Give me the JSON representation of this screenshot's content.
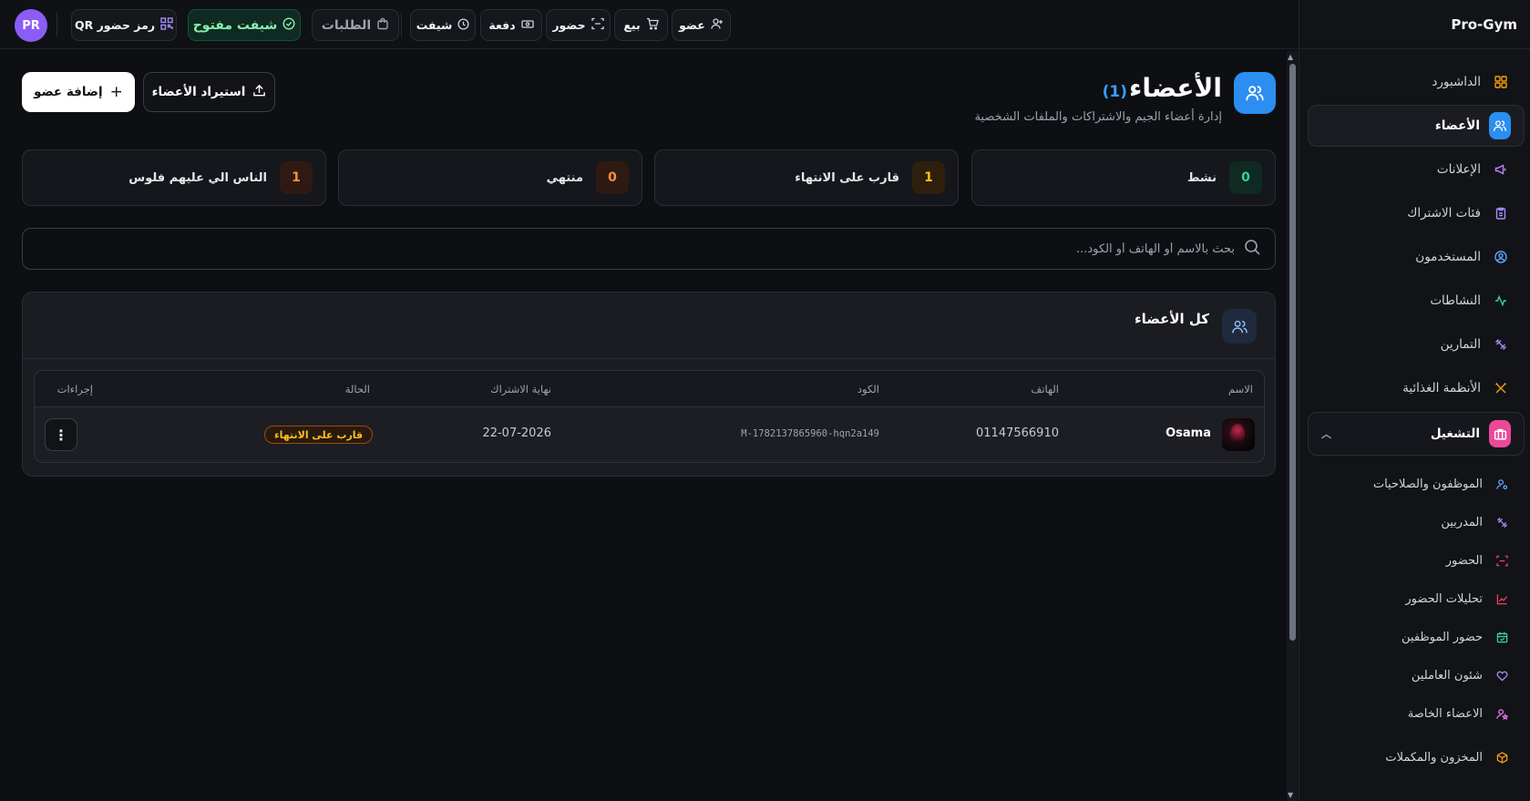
{
  "sidebar": {
    "brand": "Pro-Gym",
    "items": [
      {
        "label": "الداشبورد",
        "icon": "grid-icon",
        "color": "#f59e0b"
      },
      {
        "label": "الأعضاء",
        "icon": "users-icon",
        "color": "#ffffff",
        "bg": "#2b8ef0",
        "active": true
      },
      {
        "label": "الإعلانات",
        "icon": "megaphone-icon",
        "color": "#c084fc"
      },
      {
        "label": "فئات الاشتراك",
        "icon": "clipboard-icon",
        "color": "#a78bfa"
      },
      {
        "label": "المستخدمون",
        "icon": "user-circle-icon",
        "color": "#60a5fa"
      },
      {
        "label": "النشاطات",
        "icon": "activity-icon",
        "color": "#34d399"
      },
      {
        "label": "التمارين",
        "icon": "dumbbell-icon",
        "color": "#a78bfa"
      },
      {
        "label": "الأنظمة الغذائية",
        "icon": "utensils-icon",
        "color": "#f59e0b"
      }
    ],
    "group": {
      "label": "التشغيل",
      "icon": "briefcase-icon",
      "bg": "#ec4899"
    },
    "sub_items": [
      {
        "label": "الموظفون والصلاحيات",
        "icon": "user-cog-icon",
        "color": "#60a5fa"
      },
      {
        "label": "المدربين",
        "icon": "dumbbell-icon",
        "color": "#a78bfa"
      },
      {
        "label": "الحضور",
        "icon": "scan-icon",
        "color": "#f43f5e"
      },
      {
        "label": "تحليلات الحضور",
        "icon": "chart-line-icon",
        "color": "#f43f5e"
      },
      {
        "label": "حضور الموظفين",
        "icon": "calendar-check-icon",
        "color": "#34d399"
      },
      {
        "label": "شئون العاملين",
        "icon": "heart-handshake-icon",
        "color": "#a78bfa"
      },
      {
        "label": "الاعضاء الخاصة",
        "icon": "user-star-icon",
        "color": "#e879f9"
      },
      {
        "label": "المخزون والمكملات",
        "icon": "package-icon",
        "color": "#f59e0b"
      }
    ]
  },
  "topbar": {
    "avatar": "PR",
    "qr": "رمز حضور QR",
    "shift_open": "شيفت مفتوح",
    "requests": "الطلبات",
    "shift": "شيفت",
    "payment": "دفعة",
    "attendance": "حضور",
    "sale": "بيع",
    "member": "عضو"
  },
  "header": {
    "title": "الأعضاء",
    "count": "(1)",
    "subtitle": "إدارة أعضاء الجيم والاشتراكات والملفات الشخصية",
    "add_button": "إضافة عضو",
    "import_button": "استيراد الأعضاء"
  },
  "stats": [
    {
      "label": "نشط",
      "value": "0",
      "color": "#34d399",
      "bg": "#0f2a22"
    },
    {
      "label": "قارب على الانتهاء",
      "value": "1",
      "color": "#fbbf24",
      "bg": "#2e1f0c"
    },
    {
      "label": "منتهي",
      "value": "0",
      "color": "#fb923c",
      "bg": "#2e1a12"
    },
    {
      "label": "الناس الي عليهم فلوس",
      "value": "1",
      "color": "#fb923c",
      "bg": "#2e1a12"
    }
  ],
  "search": {
    "placeholder": "بحث بالاسم أو الهاتف أو الكود..."
  },
  "table": {
    "title": "كل الأعضاء",
    "columns": {
      "name": "الاسم",
      "phone": "الهاتف",
      "code": "الكود",
      "end": "نهاية الاشتراك",
      "status": "الحالة",
      "actions": "إجراءات"
    },
    "rows": [
      {
        "name": "Osama",
        "phone": "01147566910",
        "code": "M-1782137865960-hqn2a149",
        "end": "22-07-2026",
        "status": "قارب على الانتهاء"
      }
    ]
  }
}
